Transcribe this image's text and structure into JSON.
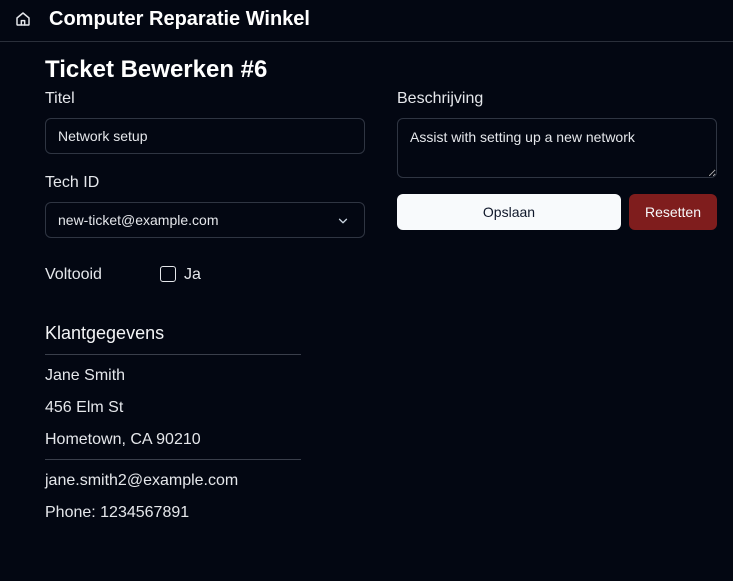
{
  "header": {
    "home_icon": "home-icon",
    "title": "Computer Reparatie Winkel"
  },
  "page": {
    "title": "Ticket Bewerken #6"
  },
  "form": {
    "title_label": "Titel",
    "title_value": "Network setup",
    "tech_label": "Tech ID",
    "tech_value": "new-ticket@example.com",
    "completed_label": "Voltooid",
    "completed_checkbox_label": "Ja",
    "completed_checked": false,
    "description_label": "Beschrijving",
    "description_value": "Assist with setting up a new network",
    "save_label": "Opslaan",
    "reset_label": "Resetten"
  },
  "customer": {
    "section_title": "Klantgegevens",
    "name": "Jane Smith",
    "street": "456 Elm St",
    "city": "Hometown, CA 90210",
    "email": "jane.smith2@example.com",
    "phone": "Phone: 1234567891"
  },
  "colors": {
    "background": "#030712",
    "save_button": "#f8fafc",
    "reset_button": "#7f1d1d"
  }
}
